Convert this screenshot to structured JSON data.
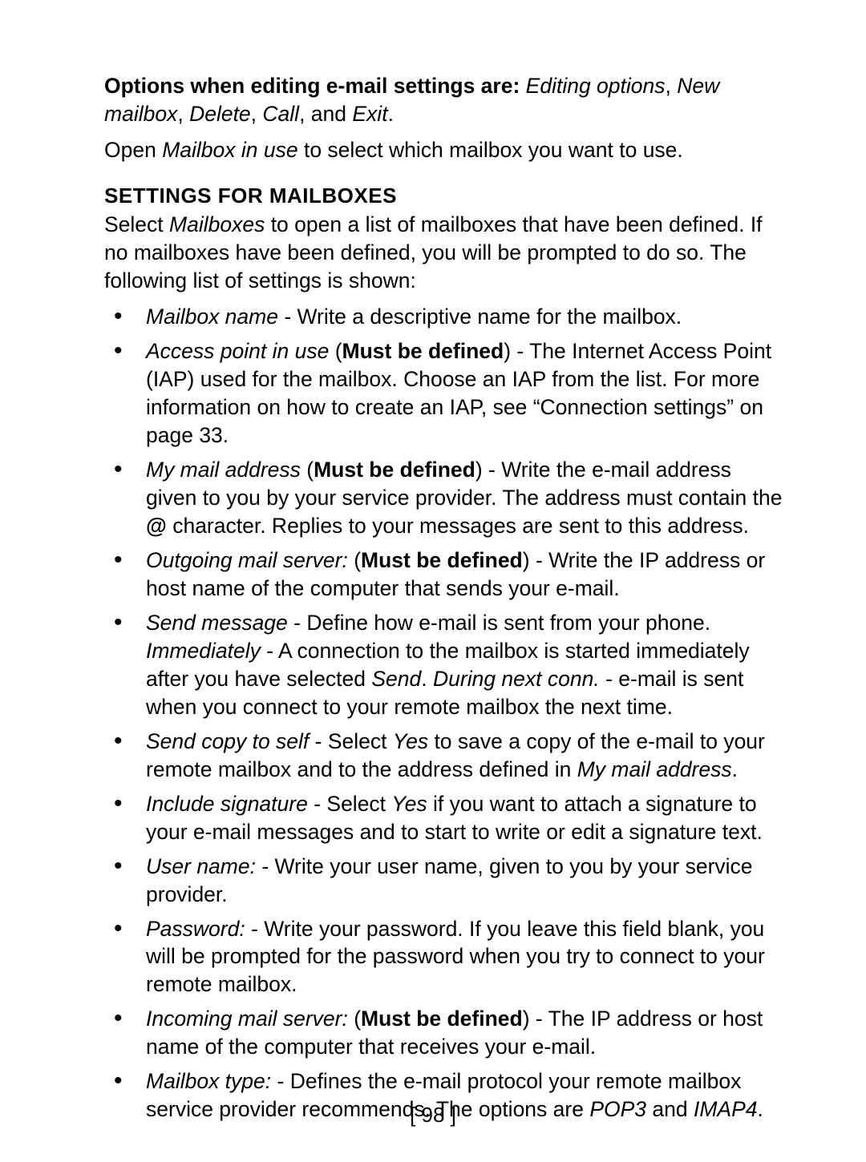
{
  "intro": {
    "options_label": "Options when editing e-mail settings are:",
    "opt1": "Editing options",
    "opt2": "New mailbox",
    "opt3": "Delete",
    "opt4": "Call",
    "and": ", and ",
    "opt5": "Exit",
    "period": ".",
    "open_pre": "Open ",
    "mailbox_in_use": "Mailbox in use",
    "open_post": " to select which mailbox you want to use."
  },
  "section_heading": "SETTINGS FOR MAILBOXES",
  "select_para": {
    "pre": "Select ",
    "mailboxes": "Mailboxes",
    "post": " to open a list of mailboxes that have been defined. If no mailboxes have been defined, you will be prompted to do so. The following list of settings is shown:"
  },
  "items": {
    "mailbox_name": {
      "term": "Mailbox name",
      "desc": " - Write a descriptive name for the mailbox."
    },
    "access_point": {
      "term": "Access point in use",
      "paren_open": " (",
      "must": "Must be defined",
      "paren_close": ")",
      "desc": " - The Internet Access Point (IAP) used for the mailbox. Choose an IAP from the list. For more information on how to create an IAP, see “Connection settings” on page 33."
    },
    "my_mail": {
      "term": "My mail address",
      "paren_open": " (",
      "must": "Must be defined",
      "paren_close": ")",
      "desc_pre": " - Write the e-mail address given to you by your service provider. The address must contain the ",
      "at": "@",
      "desc_post": " character. Replies to your messages are sent to this address."
    },
    "outgoing": {
      "term": "Outgoing mail server:",
      "paren_open": " (",
      "must": "Must be defined",
      "paren_close": ")",
      "desc": " - Write the IP address or host name of the computer that sends your e-mail."
    },
    "send_msg": {
      "term": "Send message",
      "desc1": " - Define how e-mail is sent from your phone. ",
      "imm": "Immediately",
      "desc2": " - A connection to the mailbox is started immediately after you have selected ",
      "send": "Send",
      "period_space": ". ",
      "during": "During next conn.",
      "desc3": " - e-mail is sent when you connect to your remote mailbox the next time."
    },
    "send_copy": {
      "term": "Send copy to self",
      "desc1": " - Select ",
      "yes": "Yes",
      "desc2": " to save a copy of the e-mail to your remote mailbox and to the address defined in ",
      "mymail": "My mail address",
      "period": "."
    },
    "signature": {
      "term": "Include signature",
      "desc1": " - Select ",
      "yes": "Yes",
      "desc2": " if you want to attach a signature to your e-mail messages and to start to write or edit a signature text."
    },
    "username": {
      "term": "User name:",
      "desc": " - Write your user name, given to you by your service provider."
    },
    "password": {
      "term": "Password:",
      "desc": " - Write your password. If you leave this field blank, you will be prompted for the password when you try to connect to your remote mailbox."
    },
    "incoming": {
      "term": "Incoming mail server:",
      "paren_open": " (",
      "must": "Must be defined",
      "paren_close": ")",
      "desc": " - The IP address or host name of the computer that receives your e-mail."
    },
    "mailbox_type": {
      "term": "Mailbox type:",
      "desc1": " - Defines the e-mail protocol your remote mailbox service provider recommends. The options are ",
      "pop3": "POP3",
      "and": " and ",
      "imap4": "IMAP4",
      "period": "."
    }
  },
  "page_number": "[ 98 ]"
}
